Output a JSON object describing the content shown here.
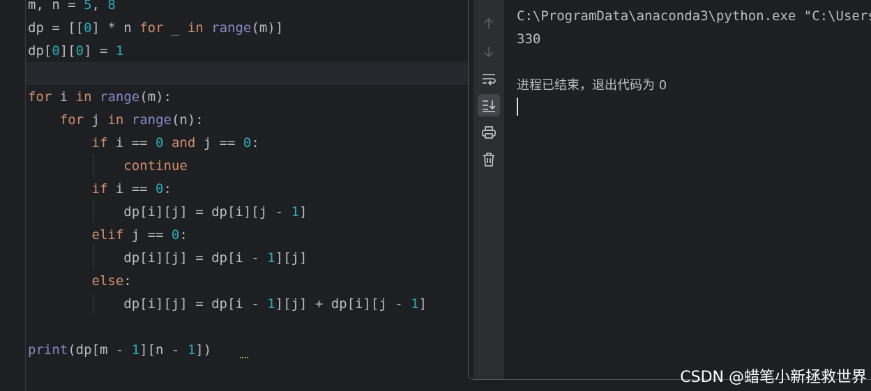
{
  "editor": {
    "lines": [
      [
        {
          "t": "m, n = "
        },
        {
          "t": "5",
          "c": "num"
        },
        {
          "t": ", "
        },
        {
          "t": "8",
          "c": "num"
        }
      ],
      [
        {
          "t": "dp = [["
        },
        {
          "t": "0",
          "c": "num"
        },
        {
          "t": "] * n "
        },
        {
          "t": "for",
          "c": "kw"
        },
        {
          "t": " _ "
        },
        {
          "t": "in",
          "c": "kw"
        },
        {
          "t": " "
        },
        {
          "t": "range",
          "c": "bi"
        },
        {
          "t": "(m)]"
        }
      ],
      [
        {
          "t": "dp["
        },
        {
          "t": "0",
          "c": "num"
        },
        {
          "t": "]["
        },
        {
          "t": "0",
          "c": "num"
        },
        {
          "t": "] = "
        },
        {
          "t": "1",
          "c": "num"
        }
      ],
      [],
      [
        {
          "t": "for",
          "c": "kw"
        },
        {
          "t": " i "
        },
        {
          "t": "in",
          "c": "kw"
        },
        {
          "t": " "
        },
        {
          "t": "range",
          "c": "bi"
        },
        {
          "t": "(m):"
        }
      ],
      [
        {
          "t": "    "
        },
        {
          "t": "for",
          "c": "kw"
        },
        {
          "t": " j "
        },
        {
          "t": "in",
          "c": "kw"
        },
        {
          "t": " "
        },
        {
          "t": "range",
          "c": "bi"
        },
        {
          "t": "(n):"
        }
      ],
      [
        {
          "t": "        "
        },
        {
          "t": "if",
          "c": "kw"
        },
        {
          "t": " i == "
        },
        {
          "t": "0",
          "c": "num"
        },
        {
          "t": " "
        },
        {
          "t": "and",
          "c": "kw"
        },
        {
          "t": " j == "
        },
        {
          "t": "0",
          "c": "num"
        },
        {
          "t": ":"
        }
      ],
      [
        {
          "t": "            "
        },
        {
          "t": "continue",
          "c": "kw"
        }
      ],
      [
        {
          "t": "        "
        },
        {
          "t": "if",
          "c": "kw"
        },
        {
          "t": " i == "
        },
        {
          "t": "0",
          "c": "num"
        },
        {
          "t": ":"
        }
      ],
      [
        {
          "t": "            dp[i][j] = dp[i][j - "
        },
        {
          "t": "1",
          "c": "num"
        },
        {
          "t": "]"
        }
      ],
      [
        {
          "t": "        "
        },
        {
          "t": "elif",
          "c": "kw"
        },
        {
          "t": " j == "
        },
        {
          "t": "0",
          "c": "num"
        },
        {
          "t": ":"
        }
      ],
      [
        {
          "t": "            dp[i][j] = dp[i - "
        },
        {
          "t": "1",
          "c": "num"
        },
        {
          "t": "][j]"
        }
      ],
      [
        {
          "t": "        "
        },
        {
          "t": "else",
          "c": "kw"
        },
        {
          "t": ":"
        }
      ],
      [
        {
          "t": "            dp[i][j] = dp[i - "
        },
        {
          "t": "1",
          "c": "num"
        },
        {
          "t": "][j] + dp[i][j - "
        },
        {
          "t": "1",
          "c": "num"
        },
        {
          "t": "]"
        }
      ],
      [],
      [
        {
          "t": "print",
          "c": "bi"
        },
        {
          "t": "(dp[m - "
        },
        {
          "t": "1",
          "c": "num"
        },
        {
          "t": "][n - "
        },
        {
          "t": "1",
          "c": "num"
        },
        {
          "t": "])"
        }
      ]
    ]
  },
  "colors": {
    "background": "#1e1f22",
    "keyword": "#cf8e6d",
    "number": "#2aacb8",
    "builtin": "#8888c6",
    "text": "#bcbec4"
  },
  "run_toolbar": {
    "buttons": [
      "arrow-up-icon",
      "arrow-down-icon",
      "soft-wrap-icon",
      "scroll-to-end-icon",
      "print-icon",
      "trash-icon"
    ]
  },
  "console": {
    "command": "C:\\ProgramData\\anaconda3\\python.exe \"C:\\Users",
    "output": "330",
    "exit_message": "进程已结束，退出代码为 0"
  },
  "watermark": "CSDN @蜡笔小新拯救世界"
}
